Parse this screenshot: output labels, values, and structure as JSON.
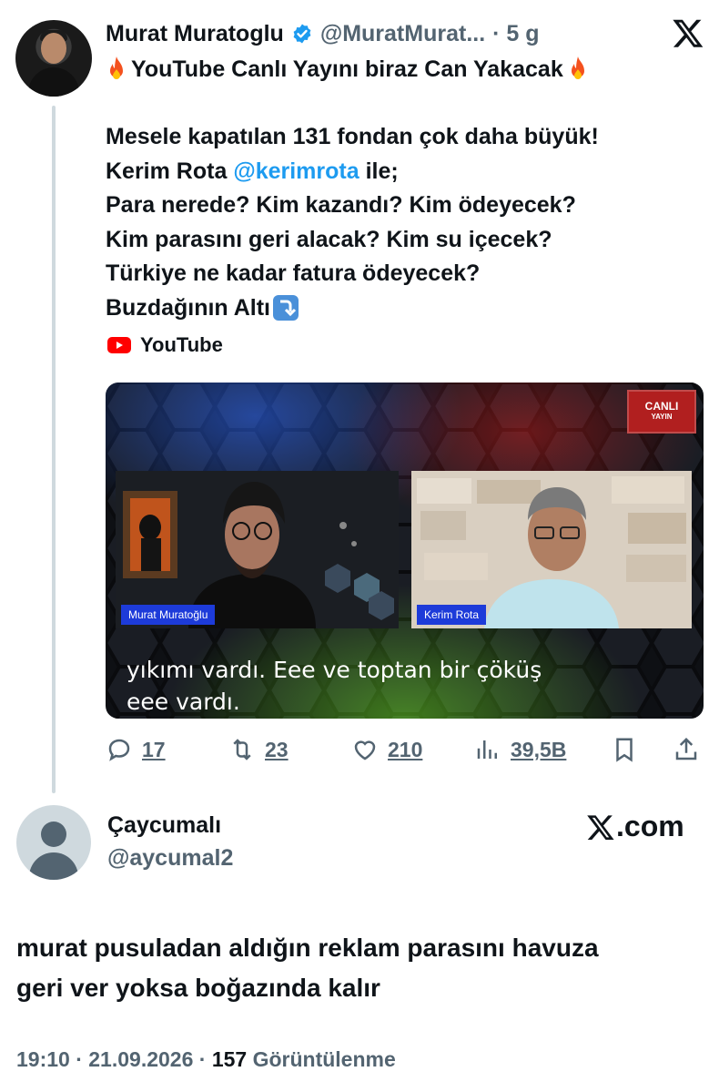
{
  "quoted_tweet": {
    "author_name": "Murat Muratoglu",
    "author_handle": "@MuratMurat...",
    "age": "· 5 g",
    "headline": "YouTube Canlı Yayını biraz Can Yakacak",
    "lines": [
      "Mesele kapatılan 131 fondan çok daha büyük!",
      "Para nerede? Kim kazandı? Kim ödeyecek?",
      "Kim parasını geri alacak? Kim su içecek?",
      "Türkiye ne kadar fatura ödeyecek?",
      "Buzdağının Altı"
    ],
    "mention_line": {
      "before": "Kerim Rota ",
      "mention": "@kerimrota",
      "after": " ile;"
    },
    "link_source": "YouTube",
    "video": {
      "live_badge_top": "CANLI",
      "live_badge_bottom": "YAYIN",
      "left_nametag": "Murat Muratoğlu",
      "right_nametag": "Kerim Rota",
      "subtitle_line1": "yıkımı vardı. Eee ve toptan bir çöküş",
      "subtitle_line2": "eee vardı."
    },
    "stats": {
      "replies": "17",
      "reposts": "23",
      "likes": "210",
      "views": "39,5B"
    }
  },
  "reply": {
    "author_name": "Çaycumalı",
    "author_handle": "@aycumal2",
    "watermark": ".com",
    "text_line1": "murat pusuladan aldığın reklam parasını havuza",
    "text_line2": "geri ver yoksa boğazında kalır",
    "timestamp": "19:10 · 21.09.2026 ·",
    "views_count": "157",
    "views_label": "Görüntülenme"
  },
  "colors": {
    "accent": "#1d9bf0",
    "secondary_text": "#536471",
    "youtube_red": "#ff0000",
    "nametag_blue": "#1d3bd9",
    "live_red": "#b11f1f"
  },
  "icons": [
    "verified-badge-icon",
    "x-logo-icon",
    "fire-emoji-icon",
    "down-right-arrow-emoji-icon",
    "youtube-icon",
    "reply-icon",
    "repost-icon",
    "like-icon",
    "views-icon",
    "bookmark-icon",
    "share-icon"
  ]
}
